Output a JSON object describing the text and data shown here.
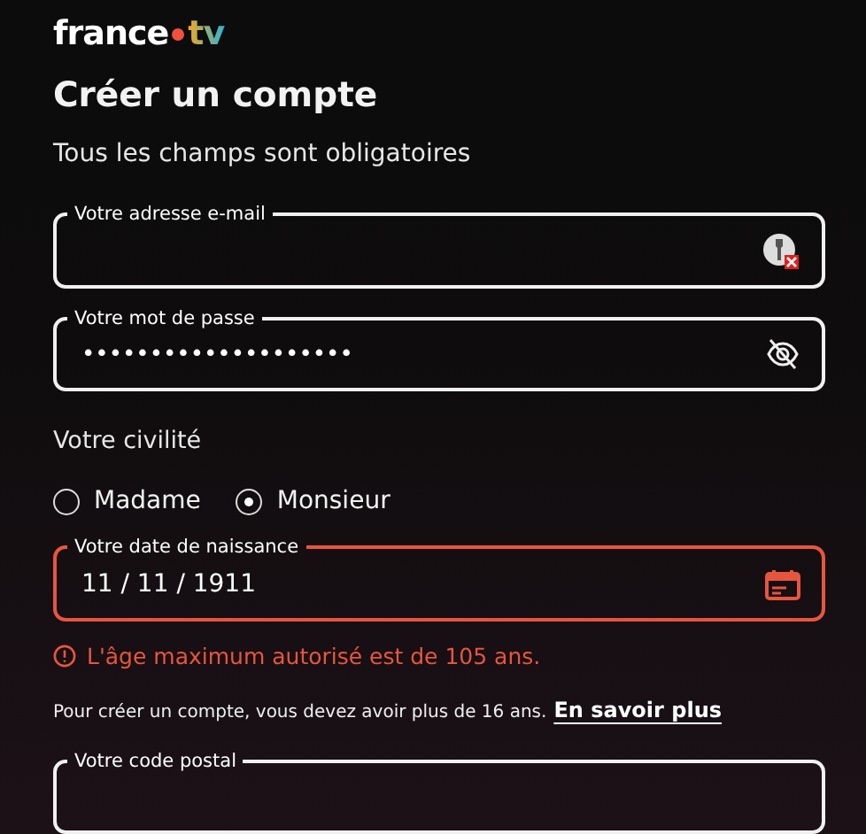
{
  "logo": {
    "word": "france",
    "suffix": "tv"
  },
  "title": "Créer un compte",
  "subtitle": "Tous les champs sont obligatoires",
  "fields": [
    {
      "kind": "email",
      "label": "Votre adresse e-mail",
      "error": false
    },
    {
      "kind": "password",
      "label": "Votre mot de passe",
      "value": "••••••••••••••••••••",
      "error": false
    }
  ],
  "civility": {
    "label": "Votre civilité",
    "options": [
      {
        "label": "Madame",
        "selected": false
      },
      {
        "label": "Monsieur",
        "selected": true
      }
    ]
  },
  "birthdate": {
    "kind": "date",
    "label": "Votre date de naissance",
    "value": "11 / 11 / 1911",
    "error": true
  },
  "error_message": "L'âge maximum autorisé est de 105 ans.",
  "note": {
    "text": "Pour créer un compte, vous devez avoir plus de 16 ans.",
    "link": "En savoir plus"
  },
  "postal": {
    "label": "Votre code postal",
    "error": false
  }
}
